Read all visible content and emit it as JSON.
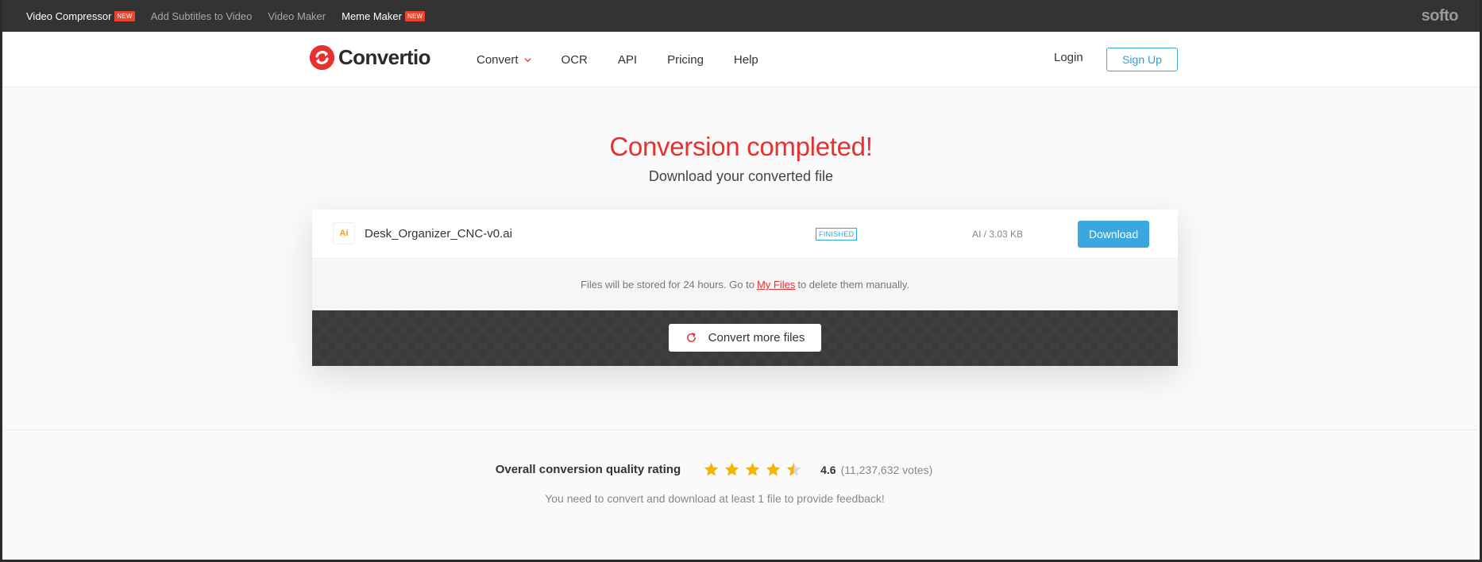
{
  "topbar": {
    "links": [
      {
        "label": "Video Compressor",
        "badge": "NEW"
      },
      {
        "label": "Add Subtitles to Video"
      },
      {
        "label": "Video Maker"
      },
      {
        "label": "Meme Maker",
        "badge": "NEW"
      }
    ],
    "brand": "softo"
  },
  "header": {
    "logo_text": "Convertio",
    "nav": [
      {
        "label": "Convert",
        "icon": "chevron-down-icon"
      },
      {
        "label": "OCR"
      },
      {
        "label": "API"
      },
      {
        "label": "Pricing"
      },
      {
        "label": "Help"
      }
    ],
    "login_label": "Login",
    "signup_label": "Sign Up"
  },
  "hero": {
    "title": "Conversion completed!",
    "subtitle": "Download your converted file"
  },
  "file": {
    "icon_label": "Ai",
    "name": "Desk_Organizer_CNC-v0.ai",
    "status": "FINISHED",
    "size": "AI / 3.03 KB",
    "download_label": "Download"
  },
  "note": {
    "before": "Files will be stored for 24 hours. Go to",
    "link": "My Files",
    "after": "to delete them manually."
  },
  "more": {
    "label": "Convert more files",
    "icon": "refresh-icon"
  },
  "rating": {
    "label": "Overall conversion quality rating",
    "value": "4.6",
    "votes": "(11,237,632 votes)",
    "stars_filled": 4.6,
    "feedback": "You need to convert and download at least 1 file to provide feedback!"
  },
  "colors": {
    "accent_red": "#e8302f",
    "accent_blue": "#3aa8de",
    "star": "#f5b400",
    "topbar": "#333333"
  }
}
